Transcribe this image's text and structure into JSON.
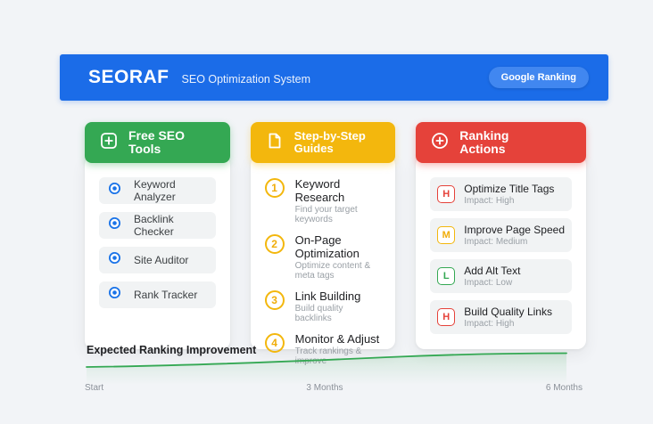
{
  "header": {
    "brand": "SEORAF",
    "tagline": "SEO Optimization System",
    "button_label": "Google Ranking"
  },
  "tools": {
    "title": "Free SEO Tools",
    "icon": "plus-square-icon",
    "items": [
      {
        "label": "Keyword Analyzer"
      },
      {
        "label": "Backlink Checker"
      },
      {
        "label": "Site Auditor"
      },
      {
        "label": "Rank Tracker"
      }
    ]
  },
  "guides": {
    "title": "Step-by-Step Guides",
    "icon": "document-icon",
    "items": [
      {
        "number": "1",
        "title": "Keyword Research",
        "subtitle": "Find your target keywords"
      },
      {
        "number": "2",
        "title": "On-Page Optimization",
        "subtitle": "Optimize content & meta tags"
      },
      {
        "number": "3",
        "title": "Link Building",
        "subtitle": "Build quality backlinks"
      },
      {
        "number": "4",
        "title": "Monitor & Adjust",
        "subtitle": "Track rankings & improve"
      }
    ]
  },
  "actions": {
    "title": "Ranking Actions",
    "icon": "plus-circle-icon",
    "items": [
      {
        "badge": "H",
        "level": "high",
        "title": "Optimize Title Tags",
        "impact": "Impact: High"
      },
      {
        "badge": "M",
        "level": "medium",
        "title": "Improve Page Speed",
        "impact": "Impact: Medium"
      },
      {
        "badge": "L",
        "level": "low",
        "title": "Add Alt Text",
        "impact": "Impact: Low"
      },
      {
        "badge": "H",
        "level": "high",
        "title": "Build Quality Links",
        "impact": "Impact: High"
      }
    ]
  },
  "chart": {
    "type": "line",
    "title": "Expected Ranking Improvement",
    "x_labels": [
      "Start",
      "3 Months",
      "6 Months"
    ],
    "trend": "gently rising curve from left to right with light green area fill",
    "line_color": "#34a853"
  },
  "colors": {
    "page_background": "#f2f4f7",
    "header_blue": "#1b6ce8",
    "button_blue": "#4187f0",
    "green": "#34a853",
    "yellow": "#f3b70d",
    "red": "#e5423a",
    "row_background": "#f1f3f4",
    "radio_blue": "#1a73e8",
    "text_dark": "#202124",
    "text_gray": "#9aa0a6"
  }
}
